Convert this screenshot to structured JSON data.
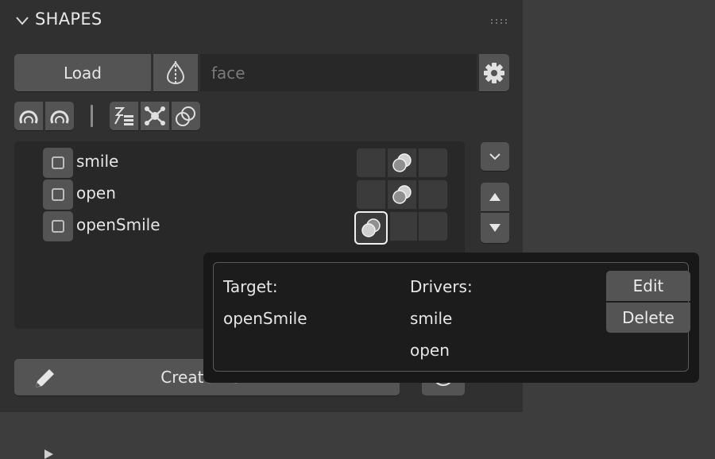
{
  "panel": {
    "title": "SHAPES"
  },
  "top_row": {
    "load_label": "Load",
    "name_field_value": "face"
  },
  "list": {
    "items": [
      {
        "label": "smile",
        "checked": false
      },
      {
        "label": "open",
        "checked": false
      },
      {
        "label": "openSmile",
        "checked": false
      }
    ]
  },
  "bottom": {
    "create_label": "Create New"
  },
  "popup": {
    "target_header": "Target:",
    "target_value": "openSmile",
    "drivers_header": "Drivers:",
    "drivers": [
      "smile",
      "open"
    ],
    "edit_label": "Edit",
    "delete_label": "Delete"
  },
  "icons": {
    "collapse": "chevron-down-icon",
    "grip": "drag-grip-icon",
    "symmetry": "symmetry-icon",
    "settings": "gear-icon",
    "arc_left": "arc-icon",
    "arc_right": "arc-icon",
    "driver_tool": "driver-list-icon",
    "nodes_tool": "node-graph-icon",
    "combo_tool": "overlap-circles-icon",
    "dropdown": "chevron-down-icon",
    "move_up": "triangle-up-icon",
    "move_down": "triangle-down-icon",
    "edit": "pencil-icon"
  },
  "colors": {
    "panel_bg": "#303030",
    "button_bg": "#545454",
    "field_bg": "#282828",
    "popup_bg": "#181818",
    "text": "#e6e6e6"
  }
}
